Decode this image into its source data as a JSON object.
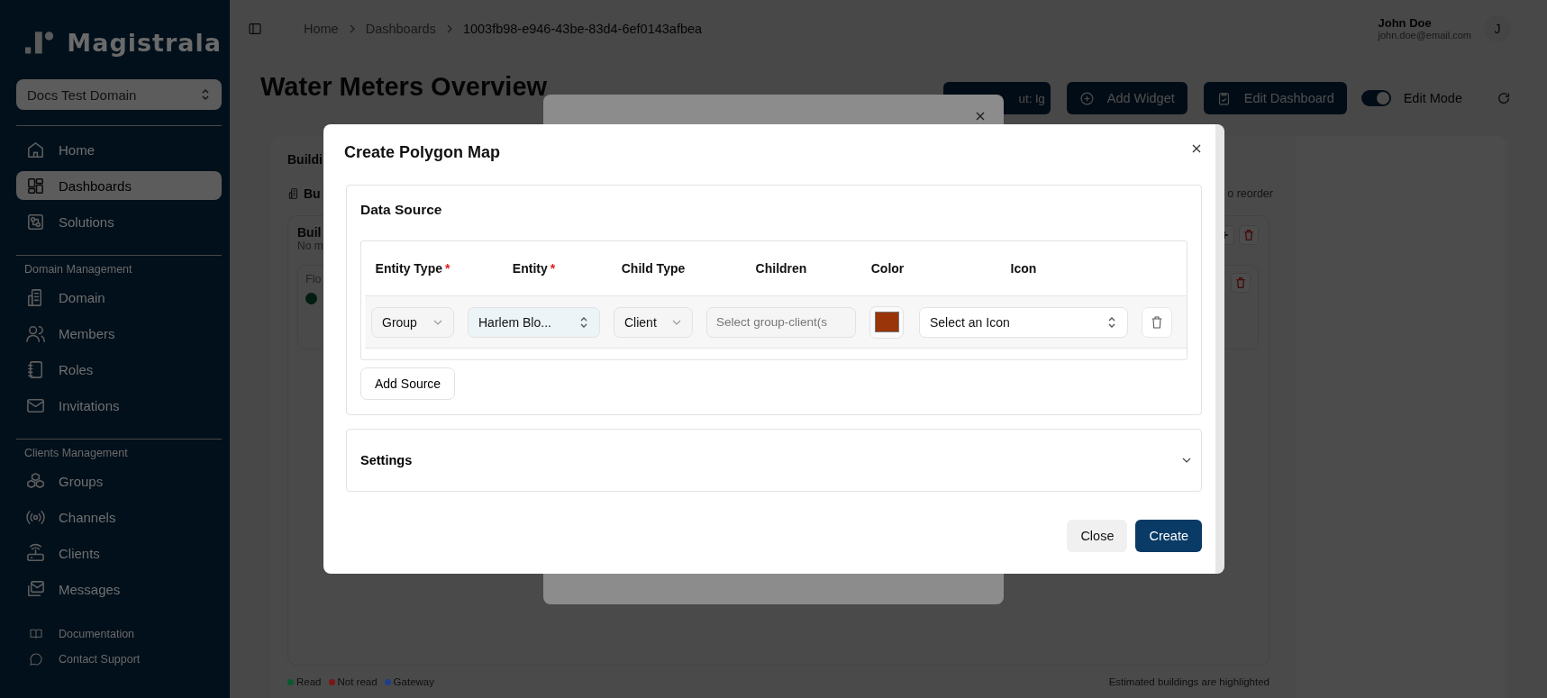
{
  "sidebar": {
    "logo": "Magistrala",
    "domain": "Docs Test Domain",
    "sections": [
      {
        "items": [
          {
            "label": "Home",
            "selected": false
          },
          {
            "label": "Dashboards",
            "selected": true
          },
          {
            "label": "Solutions",
            "selected": false
          }
        ]
      },
      {
        "heading": "Domain Management",
        "items": [
          {
            "label": "Domain",
            "selected": false
          },
          {
            "label": "Members",
            "selected": false
          },
          {
            "label": "Roles",
            "selected": false
          },
          {
            "label": "Invitations",
            "selected": false
          }
        ]
      },
      {
        "heading": "Clients Management",
        "items": [
          {
            "label": "Groups",
            "selected": false
          },
          {
            "label": "Channels",
            "selected": false
          },
          {
            "label": "Clients",
            "selected": false
          },
          {
            "label": "Messages",
            "selected": false
          }
        ]
      }
    ],
    "footer_links": [
      "Documentation",
      "Contact Support"
    ]
  },
  "header": {
    "breadcrumb": [
      "Home",
      "Dashboards",
      "1003fb98-e946-43be-83d4-6ef0143afbea"
    ],
    "user": {
      "name": "John Doe",
      "email": "john.doe@email.com",
      "initial": "J"
    }
  },
  "page": {
    "title": "Water Meters Overview",
    "actions": [
      "ut: lg",
      "Add Widget",
      "Edit Dashboard"
    ],
    "edit_mode": {
      "label": "Edit Mode",
      "on": true
    }
  },
  "board": {
    "heading": "Buildi",
    "subheading": "Bu",
    "hint": "o reorder",
    "building": {
      "title": "Buil",
      "subtitle": "No m",
      "floor": "Flo"
    },
    "legend": [
      {
        "label": "Read",
        "color": "#0a5a30"
      },
      {
        "label": "Not read",
        "color": "#7a1616"
      },
      {
        "label": "Gateway",
        "color": "#1e3f8a"
      }
    ],
    "note": "Estimated buildings are highlighted"
  },
  "modal": {
    "title": "Create Polygon Map",
    "data_source": {
      "heading": "Data Source",
      "columns": [
        {
          "label": "Entity Type",
          "required_mark": "*"
        },
        {
          "label": "Entity",
          "required_mark": "*"
        },
        {
          "label": "Child Type"
        },
        {
          "label": "Children"
        },
        {
          "label": "Color"
        },
        {
          "label": "Icon"
        }
      ],
      "rows": [
        {
          "entity_type": "Group",
          "entity": "Harlem Blo...",
          "child_type": "Client",
          "children_placeholder": "Select group-client(s",
          "color": "#9a3409",
          "icon_placeholder": "Select an Icon"
        }
      ],
      "add_button": "Add Source"
    },
    "settings": {
      "label": "Settings",
      "expanded": false
    },
    "buttons": [
      {
        "label": "Close",
        "kind": "secondary"
      },
      {
        "label": "Create",
        "kind": "primary"
      }
    ]
  }
}
